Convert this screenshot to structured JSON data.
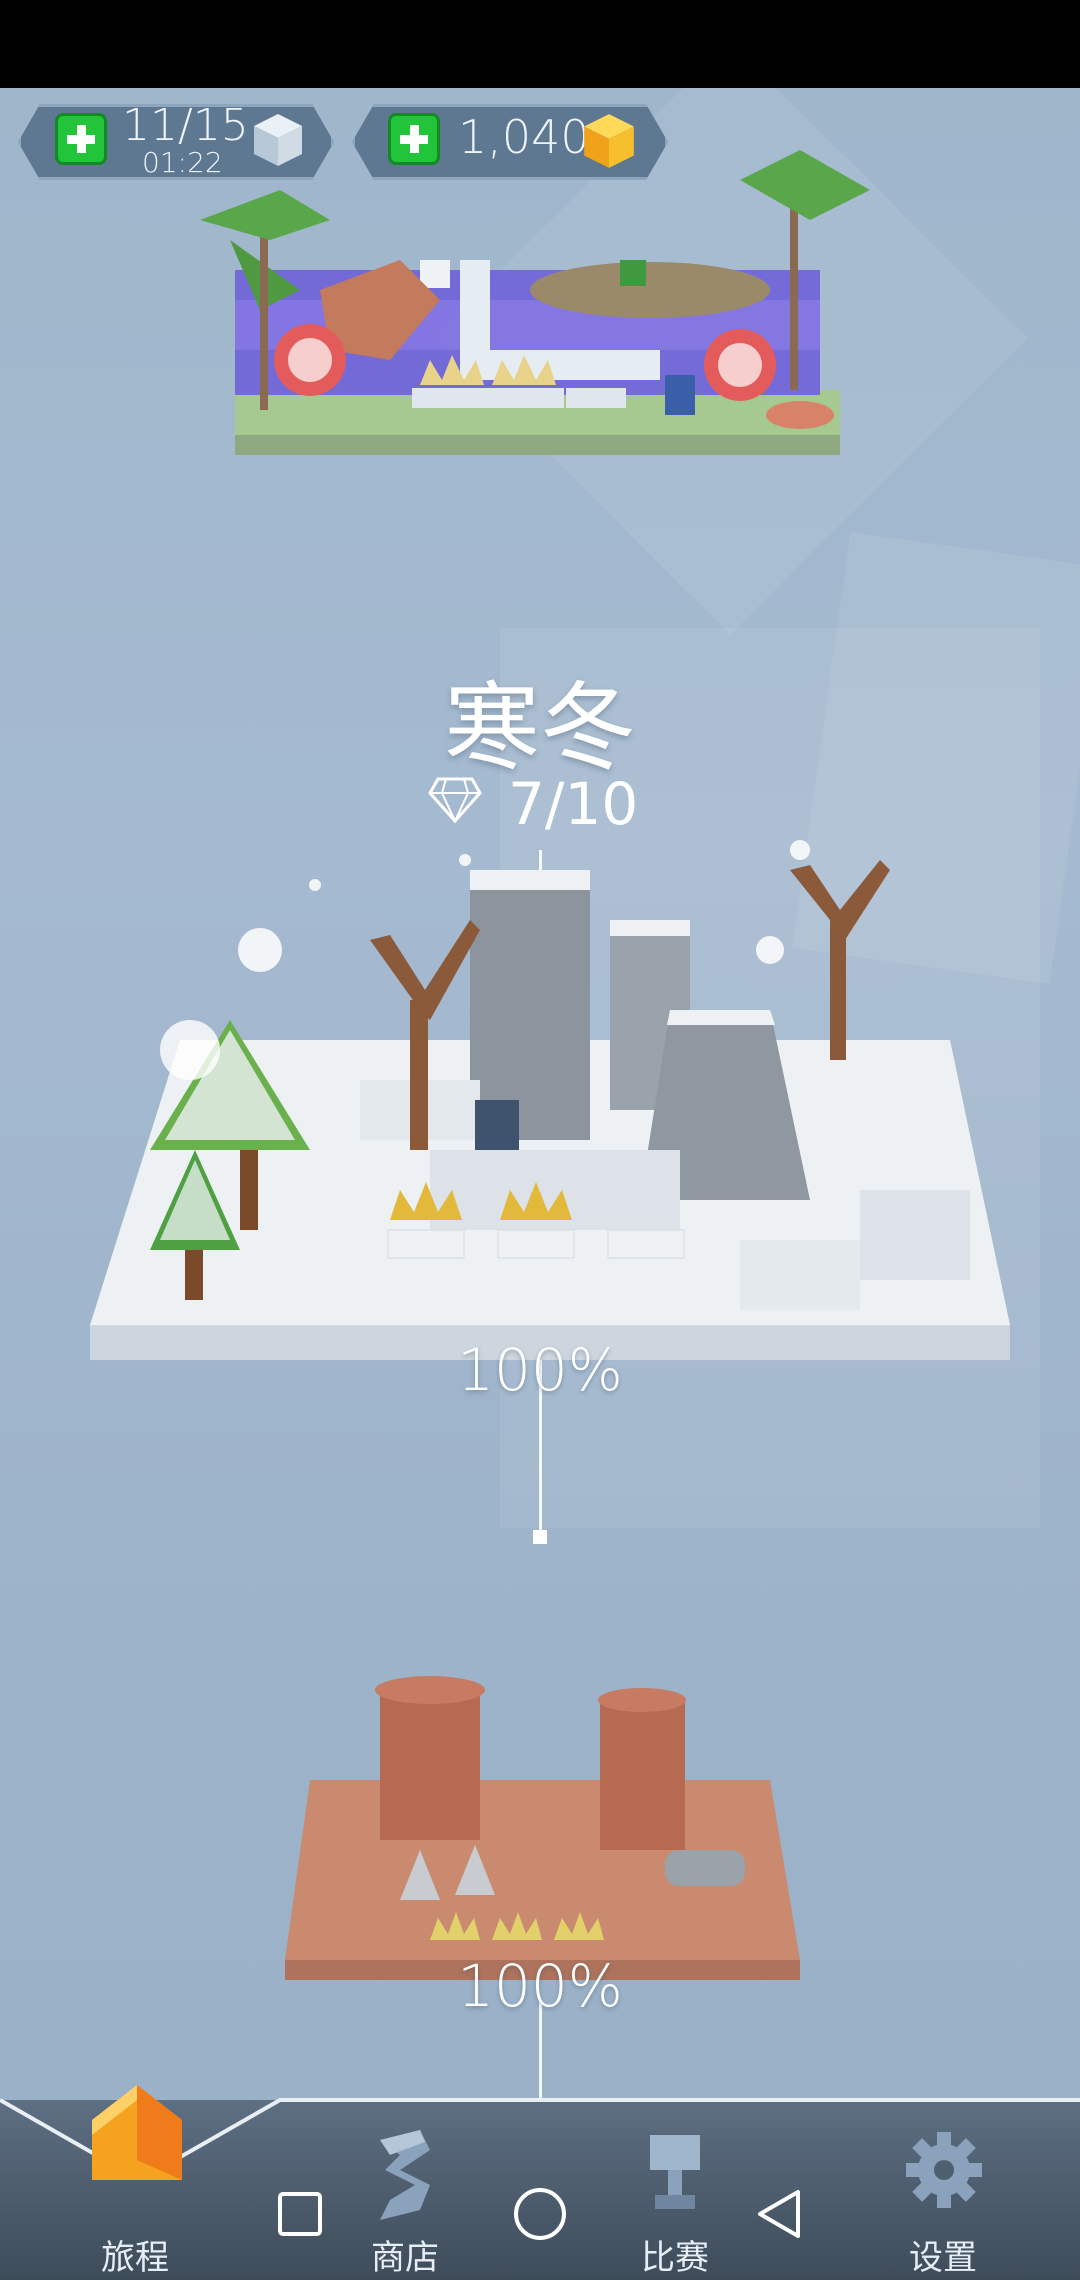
{
  "hud": {
    "energy": "11/15",
    "energy_timer": "01:22",
    "coins": "1,040"
  },
  "level": {
    "title": "寒冬",
    "gems": "7/10",
    "progress": "100%"
  },
  "next_level": {
    "progress": "100%"
  },
  "nav": {
    "journey": "旅程",
    "shop": "商店",
    "contest": "比赛",
    "settings": "设置"
  },
  "colors": {
    "sky": "#9fb4c8",
    "accent_green": "#22c43a",
    "coin_gold": "#f5b21e",
    "snow": "#eef1f4",
    "desert": "#c98a70"
  }
}
